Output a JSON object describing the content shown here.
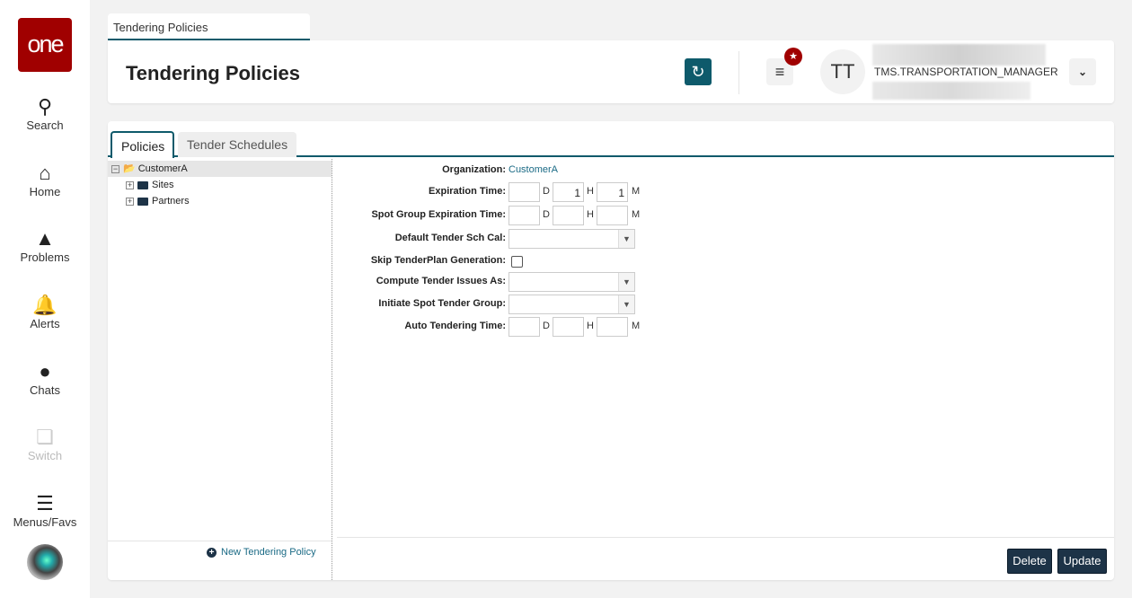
{
  "sidebar": {
    "logo": "one",
    "items": [
      {
        "label": "Search",
        "icon": "search-icon"
      },
      {
        "label": "Home",
        "icon": "home-icon"
      },
      {
        "label": "Problems",
        "icon": "warning-icon"
      },
      {
        "label": "Alerts",
        "icon": "bell-icon"
      },
      {
        "label": "Chats",
        "icon": "chat-icon"
      },
      {
        "label": "Switch",
        "icon": "switch-icon"
      },
      {
        "label": "Menus/Favs",
        "icon": "menu-icon"
      }
    ]
  },
  "page_tab": "Tendering Policies",
  "header": {
    "title": "Tendering Policies",
    "user_initials": "TT",
    "role": "TMS.TRANSPORTATION_MANAGER"
  },
  "tabs": [
    "Policies",
    "Tender Schedules"
  ],
  "tree": {
    "root": "CustomerA",
    "children": [
      "Sites",
      "Partners"
    ],
    "new_button": "New Tendering Policy"
  },
  "form": {
    "organization_label": "Organization:",
    "organization": "CustomerA",
    "expiration_label": "Expiration Time:",
    "expiration": {
      "d": "",
      "h": "1",
      "m": "1"
    },
    "spot_expiration_label": "Spot Group Expiration Time:",
    "spot_expiration": {
      "d": "",
      "h": "",
      "m": ""
    },
    "default_cal_label": "Default Tender Sch Cal:",
    "default_cal": "",
    "skip_label": "Skip TenderPlan Generation:",
    "compute_label": "Compute Tender Issues As:",
    "compute": "",
    "initiate_label": "Initiate Spot Tender Group:",
    "initiate": "",
    "auto_label": "Auto Tendering Time:",
    "auto": {
      "d": "",
      "h": "",
      "m": ""
    },
    "units": {
      "d": "D",
      "h": "H",
      "m": "M"
    }
  },
  "buttons": {
    "delete": "Delete",
    "update": "Update"
  }
}
